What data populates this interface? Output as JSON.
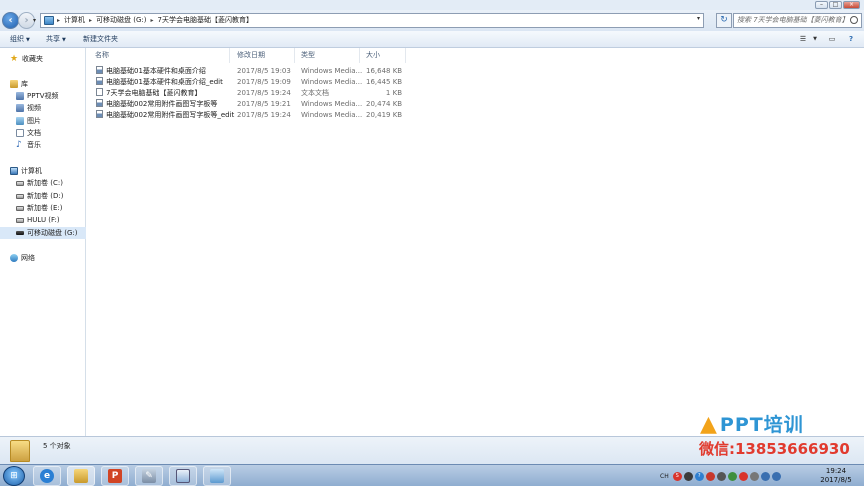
{
  "address": {
    "crumbs": [
      "计算机",
      "可移动磁盘 (G:)",
      "7天学会电脑基础【菱闪教育】"
    ],
    "search_placeholder": "搜索 7天学会电脑基础【菱闪教育】"
  },
  "toolbar": {
    "organize": "组织",
    "share": "共享",
    "new_folder": "新建文件夹"
  },
  "sidebar": {
    "favorites": "收藏夹",
    "libraries": "库",
    "lib_items": [
      "PPTV视频",
      "视频",
      "图片",
      "文档",
      "音乐"
    ],
    "computer": "计算机",
    "drives": [
      "新加卷 (C:)",
      "新加卷 (D:)",
      "新加卷 (E:)",
      "HULU (F:)",
      "可移动磁盘 (G:)"
    ],
    "network": "网络"
  },
  "columns": {
    "name": "名称",
    "date": "修改日期",
    "type": "类型",
    "size": "大小"
  },
  "files": [
    {
      "name": "电脑基础01基本硬件和桌面介绍",
      "date": "2017/8/5 19:03",
      "type": "Windows Media...",
      "size": "16,648 KB",
      "kind": "media"
    },
    {
      "name": "电脑基础01基本硬件和桌面介绍_edit",
      "date": "2017/8/5 19:09",
      "type": "Windows Media...",
      "size": "16,445 KB",
      "kind": "media"
    },
    {
      "name": "7天学会电脑基础【菱闪教育】",
      "date": "2017/8/5 19:24",
      "type": "文本文档",
      "size": "1 KB",
      "kind": "text"
    },
    {
      "name": "电脑基础002常用附件画图写字板等",
      "date": "2017/8/5 19:21",
      "type": "Windows Media...",
      "size": "20,474 KB",
      "kind": "media"
    },
    {
      "name": "电脑基础002常用附件画图写字板等_edit",
      "date": "2017/8/5 19:24",
      "type": "Windows Media...",
      "size": "20,419 KB",
      "kind": "media"
    }
  ],
  "status": {
    "count": "5 个对象"
  },
  "watermark": {
    "brand": "PPT培训",
    "contact": "微信:13853666930"
  },
  "tray": {
    "lang": "CH",
    "time": "19:24",
    "date": "2017/8/5"
  },
  "colors": {
    "accent": "#2e95d4",
    "watermark_red": "#e13a2e",
    "taskbar": "#9fb9d8"
  }
}
